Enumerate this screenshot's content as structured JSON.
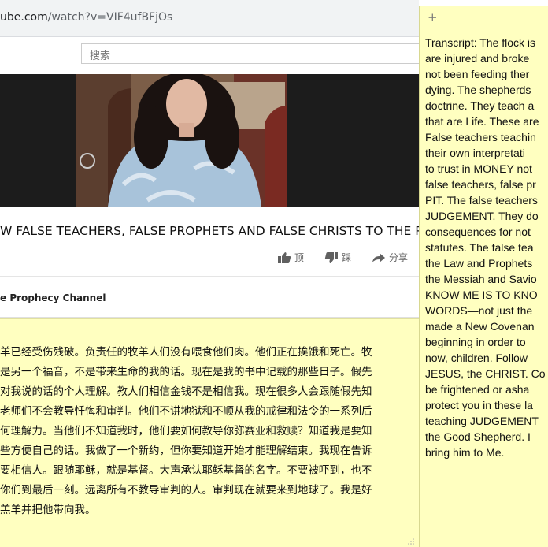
{
  "browser": {
    "url_main": "ube.com",
    "url_path": "/watch?v=VIF4ufBFjOs",
    "search_placeholder": "搜索"
  },
  "video": {
    "title": "W FALSE TEACHERS, FALSE PROPHETS AND FALSE CHRISTS TO THE PIT",
    "like_label": "顶",
    "dislike_label": "踩",
    "share_label": "分享",
    "channel": "e Prophecy Channel"
  },
  "sticky_zh": {
    "lines": [
      "羊已经受伤残破。负责任的牧羊人们没有喂食他们肉。他们正在挨饿和死亡。牧",
      "是另一个福音，不是带来生命的我的话。现在是我的书中记载的那些日子。假先",
      "对我说的话的个人理解。教人们相信金钱不是相信我。现在很多人会跟随假先知",
      "老师们不会教导忏悔和审判。他们不讲地狱和不顺从我的戒律和法令的一系列后",
      "何理解力。当他们不知道我时，他们要如何教导你弥赛亚和救赎？知道我是要知",
      "些方便自己的话。我做了一个新约，但你要知道开始才能理解结束。我现在告诉",
      "要相信人。跟随耶稣，就是基督。大声承认耶稣基督的名字。不要被吓到，也不",
      "你们到最后一刻。远离所有不教导审判的人。审判现在就要来到地球了。我是好",
      "羔羊并把他带向我。"
    ]
  },
  "sticky_en": {
    "add_label": "+",
    "lines": [
      "Transcript: The flock is",
      "are injured and broke",
      "not been feeding ther",
      "dying. The shepherds",
      "doctrine. They teach a",
      "that are Life. These are",
      "False teachers teachin",
      "their own interpretati",
      "to trust in MONEY not",
      "false teachers, false pr",
      "PIT. The false teachers",
      "JUDGEMENT. They do",
      "consequences for not",
      "statutes. The false tea",
      "the Law and Prophets",
      "the Messiah and Savio",
      "KNOW ME IS TO KNO",
      "WORDS—not just the",
      "made a New Covenan",
      "beginning in order to",
      "now, children. Follow",
      "JESUS, the CHRIST. Co",
      "be frightened or asha",
      "protect you in these la",
      "teaching JUDGEMENT",
      "the Good Shepherd. I",
      "bring him to Me."
    ]
  }
}
